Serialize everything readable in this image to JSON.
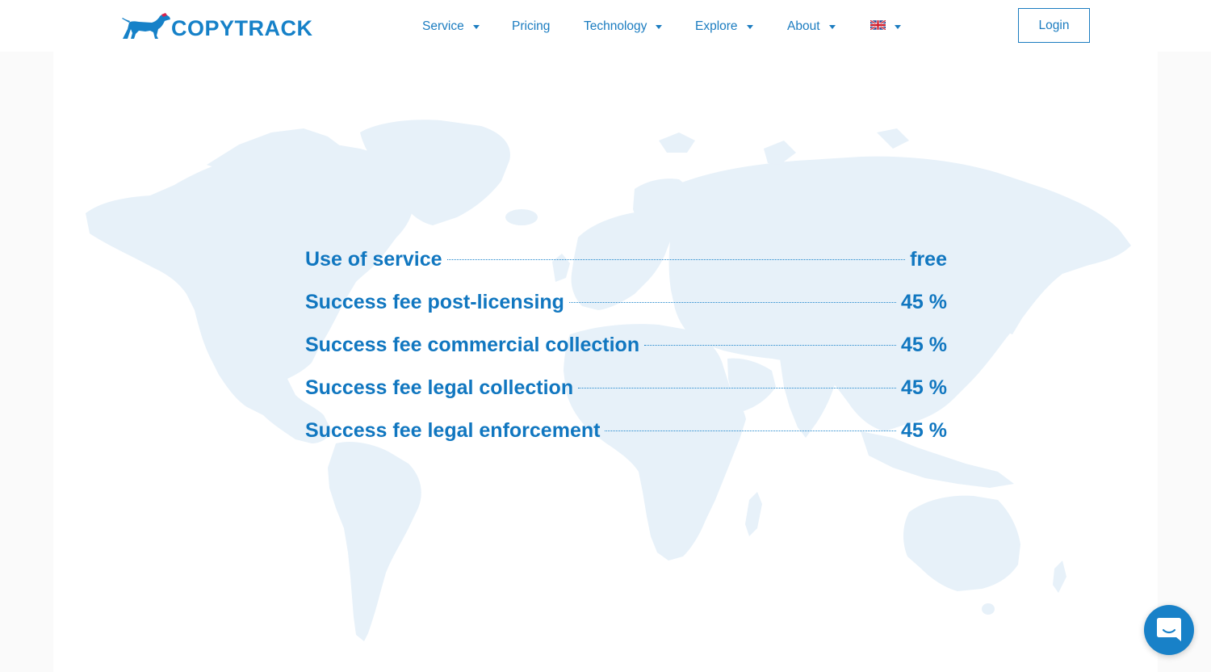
{
  "brand": {
    "name": "COPYTRACK",
    "logo_icon": "dog-logo-icon",
    "color": "#1681c8",
    "accent": "#d9234e"
  },
  "nav": {
    "items": [
      {
        "label": "Service",
        "has_dropdown": true
      },
      {
        "label": "Pricing",
        "has_dropdown": false
      },
      {
        "label": "Technology",
        "has_dropdown": true
      },
      {
        "label": "Explore",
        "has_dropdown": true
      },
      {
        "label": "About",
        "has_dropdown": true
      }
    ],
    "language": {
      "icon": "uk-flag-icon",
      "has_dropdown": true
    },
    "login_label": "Login"
  },
  "pricing": {
    "rows": [
      {
        "label": "Use of service",
        "value": "free"
      },
      {
        "label": "Success fee post-licensing",
        "value": "45 %"
      },
      {
        "label": "Success fee commercial collection",
        "value": "45 %"
      },
      {
        "label": "Success fee legal collection",
        "value": "45 %"
      },
      {
        "label": "Success fee legal enforcement",
        "value": "45 %"
      }
    ],
    "text_color": "#1177c0",
    "map_color": "#e7f1f9"
  },
  "chat": {
    "icon": "chat-bubble-icon",
    "color": "#1881c8"
  }
}
